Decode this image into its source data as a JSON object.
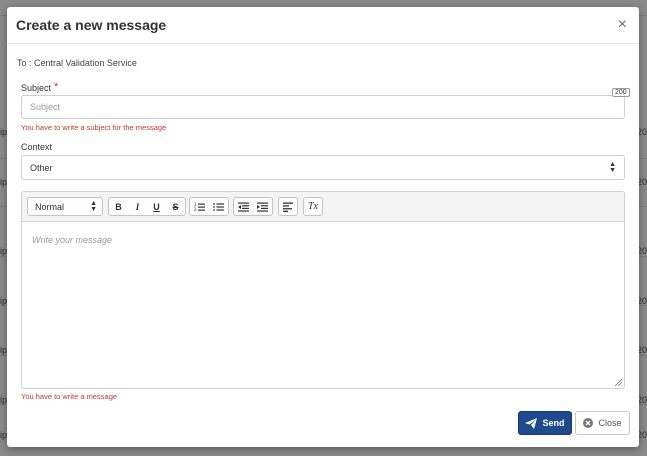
{
  "background": {
    "left_fragment": "ip",
    "right_fragment": "20"
  },
  "modal": {
    "title": "Create a new message",
    "close_glyph": "×",
    "to_line": "To : Central Validation Service",
    "subject": {
      "label": "Subject",
      "required_mark": "*",
      "placeholder": "Subject",
      "value": "",
      "max_length_badge": "200",
      "error": "You have to write a subject for the message"
    },
    "context": {
      "label": "Context",
      "selected": "Other",
      "caret_up": "▲",
      "caret_down": "▼"
    },
    "editor": {
      "toolbar": {
        "format_select": "Normal",
        "bold": "B",
        "italic": "I",
        "underline": "U",
        "strike": "S",
        "ordered_list_icon": "ordered-list-icon",
        "bullet_list_icon": "bullet-list-icon",
        "outdent_icon": "outdent-icon",
        "indent_icon": "indent-icon",
        "align_icon": "align-left-icon",
        "clear_format_label": "Tx"
      },
      "placeholder": "Write your message",
      "error": "You have to write a message"
    },
    "buttons": {
      "send": "Send",
      "close": "Close",
      "send_icon": "paper-plane-icon",
      "close_icon": "times-circle-icon"
    }
  }
}
